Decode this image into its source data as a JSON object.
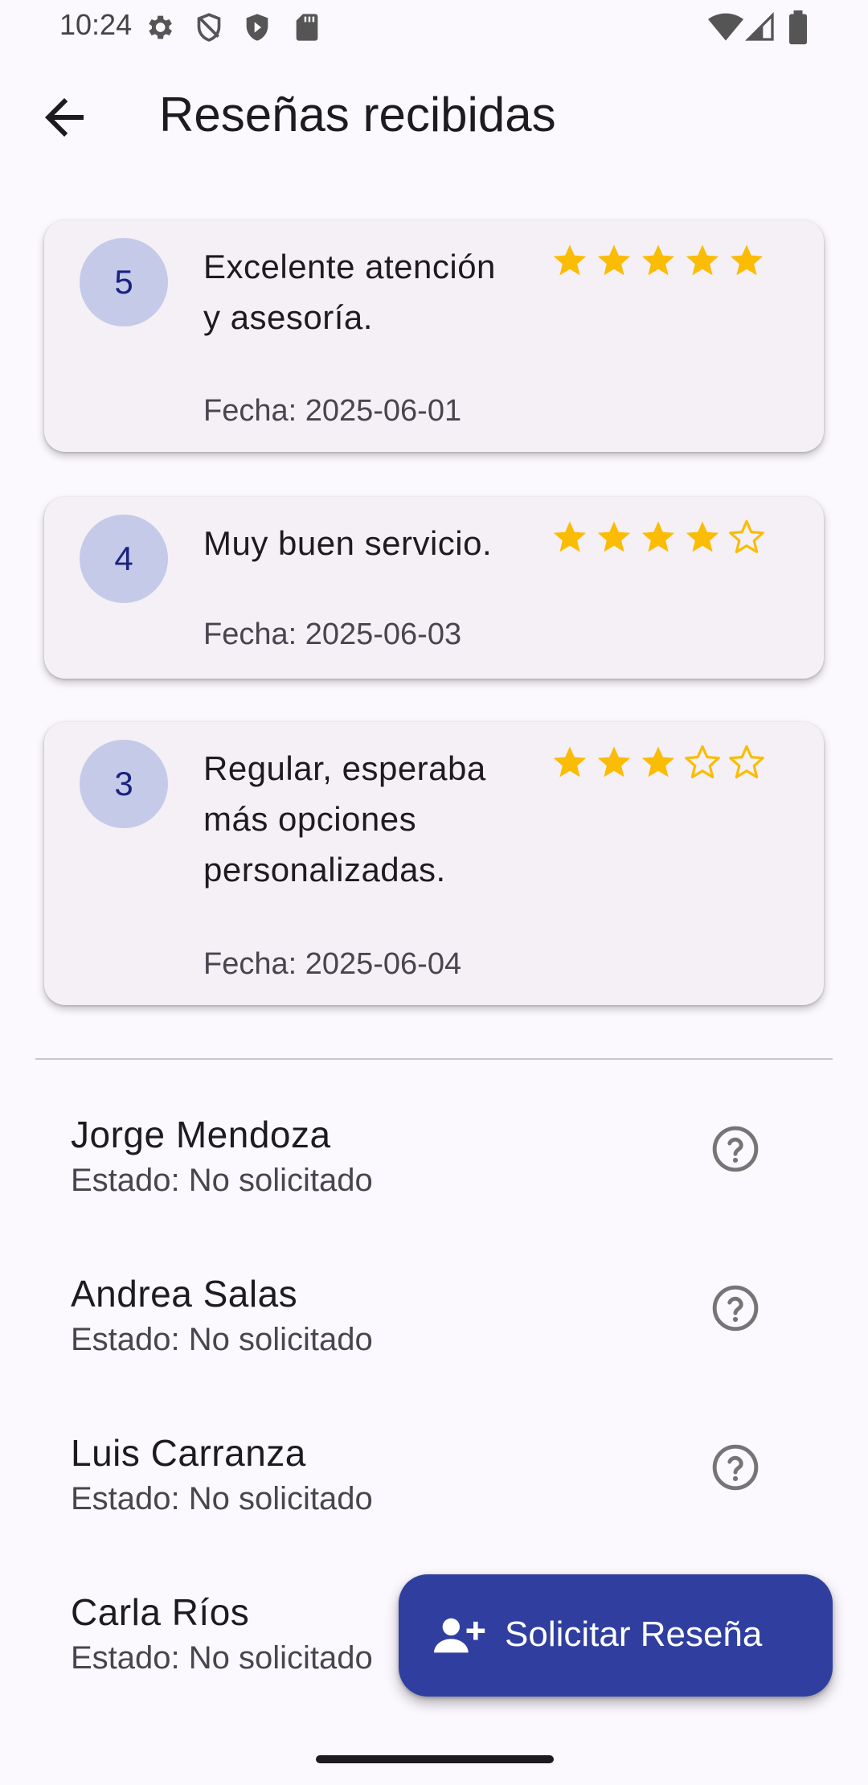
{
  "status_bar": {
    "time": "10:24",
    "left_icons": [
      "settings-icon",
      "shield-icon",
      "play-protect-icon",
      "sd-card-icon"
    ],
    "right_icons": [
      "wifi-icon",
      "signal-icon",
      "battery-icon"
    ]
  },
  "app_bar": {
    "title": "Reseñas recibidas",
    "back_icon": "arrow-left-icon"
  },
  "reviews": [
    {
      "rating": "5",
      "comment": "Excelente atención y asesoría.",
      "date": "Fecha: 2025-06-01",
      "stars_filled": 5,
      "stars_total": 5
    },
    {
      "rating": "4",
      "comment": "Muy buen servicio.",
      "date": "Fecha: 2025-06-03",
      "stars_filled": 4,
      "stars_total": 5
    },
    {
      "rating": "3",
      "comment": "Regular, esperaba más opciones personalizadas.",
      "date": "Fecha: 2025-06-04",
      "stars_filled": 3,
      "stars_total": 5
    }
  ],
  "requests": [
    {
      "name": "Jorge Mendoza",
      "status": "Estado: No solicitado",
      "icon": "help-circle-icon"
    },
    {
      "name": "Andrea Salas",
      "status": "Estado: No solicitado",
      "icon": "help-circle-icon"
    },
    {
      "name": "Luis Carranza",
      "status": "Estado: No solicitado",
      "icon": "help-circle-icon"
    },
    {
      "name": "Carla Ríos",
      "status": "Estado: No solicitado",
      "icon": "help-circle-icon"
    }
  ],
  "fab": {
    "label": "Solicitar Reseña",
    "icon": "person-add-icon"
  },
  "colors": {
    "background": "#fbf8fe",
    "card": "#f4f0f6",
    "avatar_bg": "#c5cae9",
    "avatar_text": "#1a237e",
    "star": "#fbbc05",
    "fab": "#303f9f"
  }
}
